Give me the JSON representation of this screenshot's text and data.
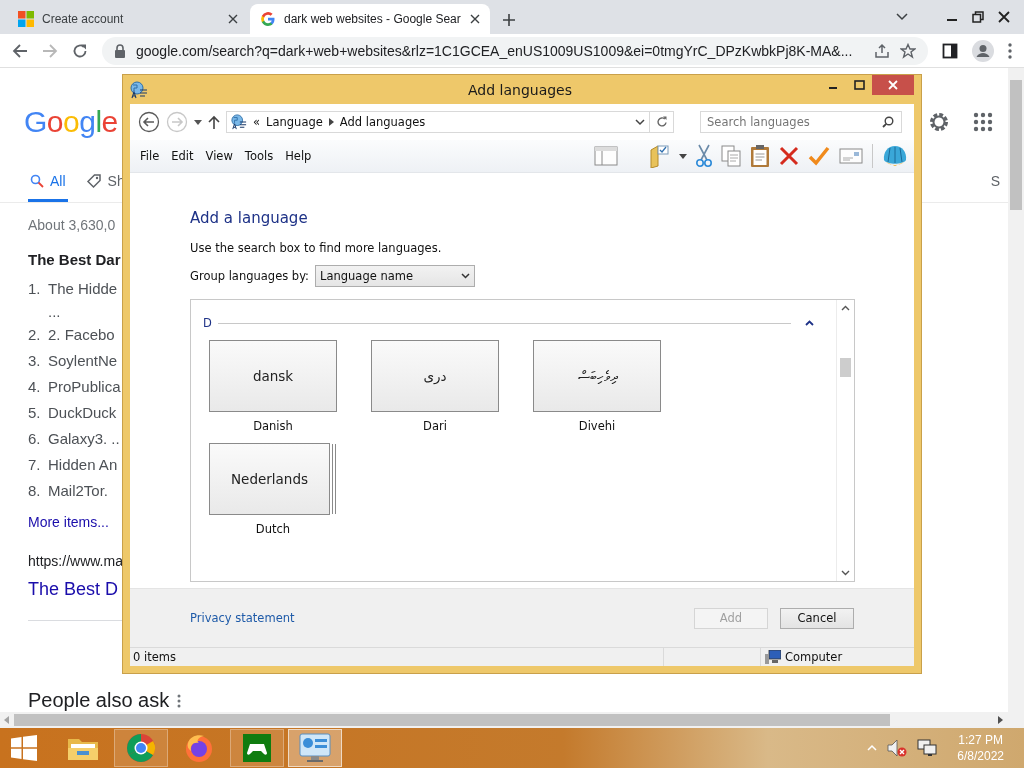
{
  "browser": {
    "tabs": [
      {
        "title": "Create account",
        "selected": false
      },
      {
        "title": "dark web websites - Google Sear",
        "selected": true
      }
    ],
    "back": {
      "disabled": false
    },
    "forward": {
      "disabled": true
    },
    "address": "google.com/search?q=dark+web+websites&rlz=1C1GCEA_enUS1009US1009&ei=0tmgYrC_DPzKwbkPj8K-MA&..."
  },
  "google_page": {
    "logo": "Google",
    "search_tabs": [
      {
        "label": "All",
        "selected": true
      },
      {
        "label": "Sh",
        "selected": false
      }
    ],
    "right_tab": "S",
    "result_stats": "About 3,630,0",
    "featured_title": "The Best Dar",
    "list": [
      {
        "number": "1.",
        "text": "The Hidde",
        "continuation": "..."
      },
      {
        "number": "2.",
        "text": "2. Facebo"
      },
      {
        "number": "3.",
        "text": "SoylentNe"
      },
      {
        "number": "4.",
        "text": "ProPublica"
      },
      {
        "number": "5.",
        "text": "DuckDuck"
      },
      {
        "number": "6.",
        "text": "Galaxy3. .."
      },
      {
        "number": "7.",
        "text": "Hidden An"
      },
      {
        "number": "8.",
        "text": "Mail2Tor."
      }
    ],
    "more_link": "More items...",
    "url": "https://www.ma",
    "result_title": "The Best D",
    "people_also_ask": "People also ask"
  },
  "dialog": {
    "title": "Add languages",
    "back": {
      "disabled": false
    },
    "forward": {
      "disabled": true
    },
    "breadcrumb": {
      "prefix": "«",
      "items": [
        "Language",
        "Add languages"
      ]
    },
    "search_placeholder": "Search languages",
    "menu": [
      "File",
      "Edit",
      "View",
      "Tools",
      "Help"
    ],
    "heading": "Add a language",
    "hint": "Use the search box to find more languages.",
    "group_by": {
      "label": "Group languages by:",
      "value": "Language name"
    },
    "groups": [
      {
        "letter": "D",
        "expanded": true,
        "languages": [
          {
            "native": "dansk",
            "name": "Danish",
            "stacked": false
          },
          {
            "native": "دری",
            "name": "Dari",
            "stacked": false
          },
          {
            "native": "ދިވެހިބަސް",
            "name": "Divehi",
            "stacked": false
          },
          {
            "native": "Nederlands",
            "name": "Dutch",
            "stacked": true
          }
        ]
      }
    ],
    "privacy_link": "Privacy statement",
    "buttons": [
      {
        "label": "Add",
        "disabled": true
      },
      {
        "label": "Cancel",
        "disabled": false
      }
    ],
    "status": {
      "items": "0 items",
      "location": "Computer"
    }
  },
  "taskbar": {
    "apps": [
      {
        "kind": "explorer",
        "running": false,
        "active": false
      },
      {
        "kind": "chrome",
        "running": true,
        "active": false
      },
      {
        "kind": "firefox",
        "running": false,
        "active": false
      },
      {
        "kind": "games",
        "running": true,
        "active": false
      },
      {
        "kind": "control-panel",
        "running": true,
        "active": true
      }
    ],
    "time": "1:27 PM",
    "date": "6/8/2022"
  }
}
